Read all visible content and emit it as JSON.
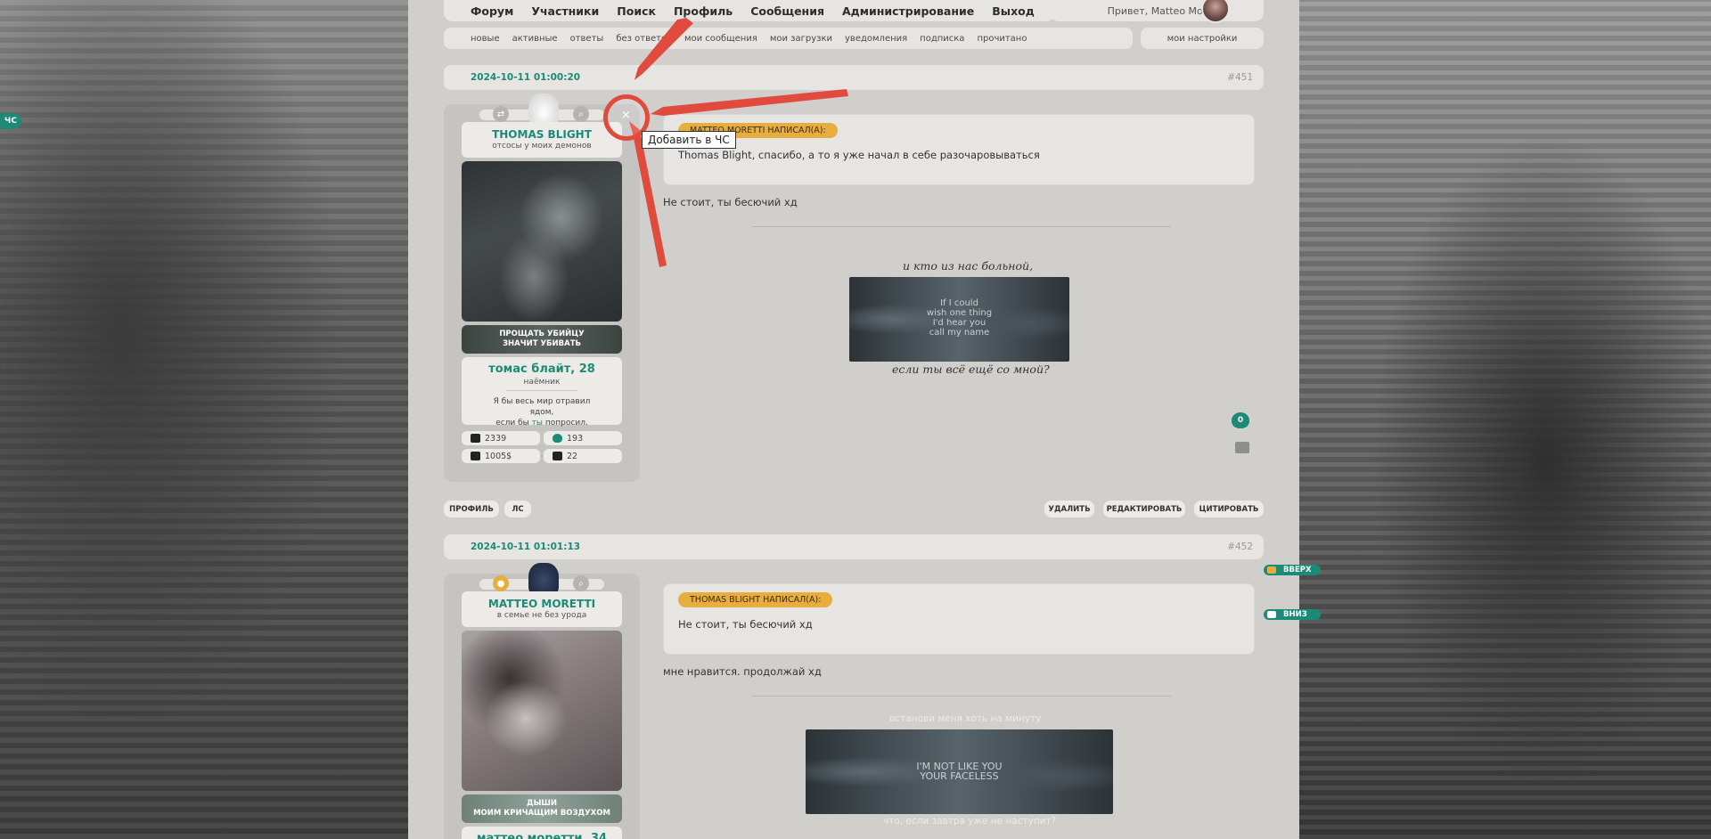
{
  "nav": {
    "items": [
      "Форум",
      "Участники",
      "Поиск",
      "Профиль",
      "Сообщения",
      "Администрирование",
      "Выход"
    ],
    "greeting": "Привет, Matteo Moretti."
  },
  "subnav": {
    "items": [
      "новые",
      "активные",
      "ответы",
      "без ответов",
      "мои сообщения",
      "мои загрузки",
      "уведомления",
      "подписка",
      "прочитано"
    ],
    "settings": "мои настройки"
  },
  "side_tab": "ЧС",
  "tooltip": "Добавить в ЧС",
  "close_glyph": "×",
  "posts": [
    {
      "date": "2024-10-11 01:00:20",
      "number": "#451",
      "author": {
        "name": "THOMAS BLIGHT",
        "status": "отсосы у моих демонов",
        "banner_line1": "ПРОЩАТЬ УБИЙЦУ",
        "banner_line2": "ЗНАЧИТ УБИВАТЬ",
        "title": "томас блайт, 28",
        "role": "наёмник",
        "quote_a": "Я бы весь мир отравил ядом,",
        "quote_b": "если бы",
        "quote_link": "ты",
        "quote_c": "попросил.",
        "posts_count": "2339",
        "respect": "193",
        "money": "1005$",
        "messages": "22"
      },
      "quote_header": "MATTEO MORETTI НАПИСАЛ(А):",
      "quote_text": "Thomas Blight, спасибо, а то я уже начал в себе разочаровываться",
      "message": "Не стоит, ты бесючий хд",
      "caption_top": "и кто из нас больной,",
      "gif_line1": "If I could",
      "gif_line2": "wish one thing",
      "gif_line3": "I'd hear you",
      "gif_line4": "call my name",
      "caption_bottom": "если ты всё ещё со мной?",
      "likes": "0",
      "buttons": {
        "profile": "ПРОФИЛЬ",
        "pm": "ЛС",
        "delete": "УДАЛИТЬ",
        "edit": "РЕДАКТИРОВАТЬ",
        "quote": "ЦИТИРОВАТЬ"
      }
    },
    {
      "date": "2024-10-11 01:01:13",
      "number": "#452",
      "author": {
        "name": "MATTEO MORETTI",
        "status": "в семье не без урода",
        "banner_line1": "ДЫШИ",
        "banner_line2": "МОИМ КРИЧАЩИМ ВОЗДУХОМ",
        "title": "маттео моретти, 34"
      },
      "quote_header": "THOMAS BLIGHT НАПИСАЛ(А):",
      "quote_text": "Не стоит, ты бесючий хд",
      "message": "мне нравится. продолжай хд",
      "caption_top": "останови меня хоть на минуту",
      "gif_line1": "I'M NOT LIKE YOU",
      "gif_line2": "YOUR FACELESS",
      "caption_bottom": "что, если завтра уже не наступит?"
    }
  ],
  "float": {
    "up": "ВВЕРХ",
    "down": "ВНИЗ"
  },
  "colors": {
    "accent": "#1d8a77",
    "quote_badge": "#e7ad3f",
    "panel": "#e6e5e2",
    "page": "#d0cfcc",
    "annotation": "#e04b3e"
  }
}
